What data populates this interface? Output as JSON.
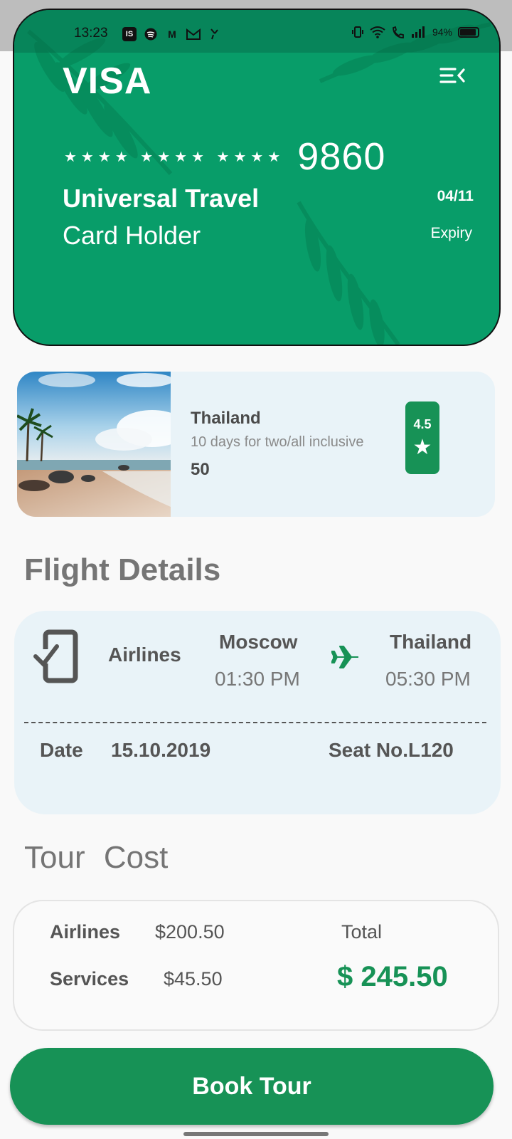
{
  "status_bar": {
    "time": "13:23",
    "left_icons": [
      "is-badge-icon",
      "spotify-icon",
      "m-logo-icon",
      "gmail-icon",
      "missed-call-icon"
    ],
    "right_icons": [
      "vibrate-icon",
      "wifi-icon",
      "wifi-call-icon",
      "signal-icon"
    ],
    "battery": "94%"
  },
  "card": {
    "brand": "VISA",
    "masked": "**** **** ****",
    "last4": "9860",
    "holder_name": "Universal Travel",
    "holder_label": "Card Holder",
    "expiry": "04/11",
    "expiry_label": "Expiry",
    "menu_icon": "menu-collapse-icon",
    "color": "#089d69"
  },
  "tour": {
    "title": "Thailand",
    "subtitle": "10 days for two/all inclusive",
    "price": "50",
    "rating": "4.5",
    "rating_icon": "star-icon"
  },
  "flight": {
    "section_title": "Flight Details",
    "airlines_label": "Airlines",
    "from_city": "Moscow",
    "from_time": "01:30 PM",
    "to_city": "Thailand",
    "to_time": "05:30 PM",
    "date_label": "Date",
    "date_value": "15.10.2019",
    "seat": "Seat No.L120"
  },
  "cost": {
    "section_title": "Tour Cost",
    "airlines_label": "Airlines",
    "airlines_value": "$200.50",
    "services_label": "Services",
    "services_value": "$45.50",
    "total_label": "Total",
    "total_value": "$ 245.50"
  },
  "actions": {
    "book_label": "Book Tour"
  },
  "colors": {
    "accent": "#179256",
    "panel": "#e9f3f8"
  }
}
